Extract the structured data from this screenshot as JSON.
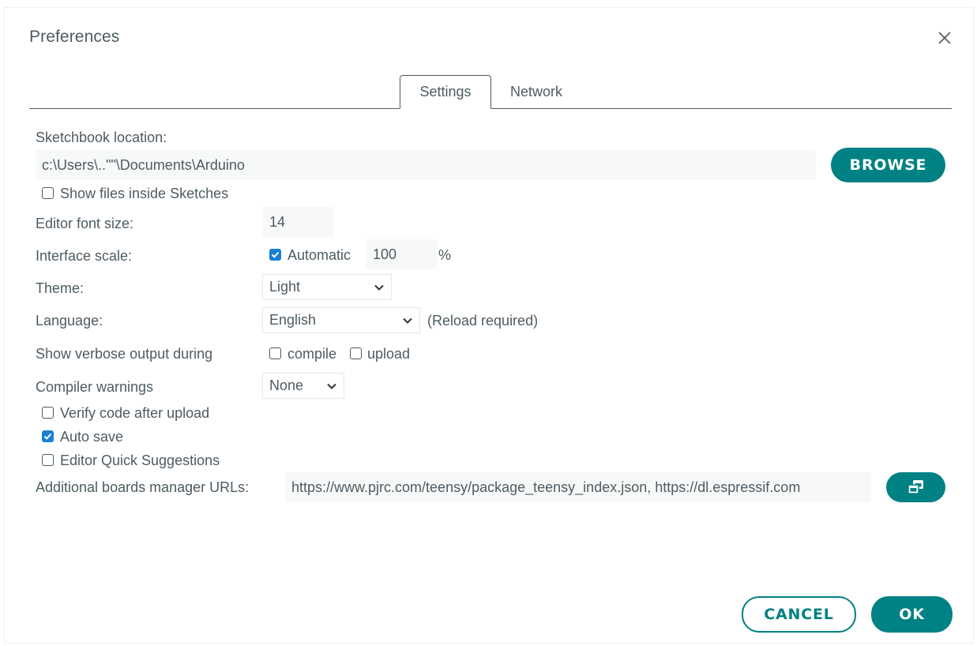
{
  "dialog": {
    "title": "Preferences",
    "close_icon": "close-icon"
  },
  "tabs": [
    {
      "label": "Settings",
      "active": true
    },
    {
      "label": "Network",
      "active": false
    }
  ],
  "settings": {
    "sketchbook_label": "Sketchbook location:",
    "sketchbook_path": "c:\\Users\\..\"\"\\Documents\\Arduino",
    "browse_label": "BROWSE",
    "show_files_label": "Show files inside Sketches",
    "show_files_checked": false,
    "font_size_label": "Editor font size:",
    "font_size_value": "14",
    "interface_scale_label": "Interface scale:",
    "automatic_label": "Automatic",
    "automatic_checked": true,
    "scale_value": "100",
    "scale_unit": "%",
    "theme_label": "Theme:",
    "theme_value": "Light",
    "language_label": "Language:",
    "language_value": "English",
    "reload_note": "(Reload required)",
    "verbose_label": "Show verbose output during",
    "compile_label": "compile",
    "compile_checked": false,
    "upload_label": "upload",
    "upload_checked": false,
    "warnings_label": "Compiler warnings",
    "warnings_value": "None",
    "verify_label": "Verify code after upload",
    "verify_checked": false,
    "autosave_label": "Auto save",
    "autosave_checked": true,
    "quick_suggestions_label": "Editor Quick Suggestions",
    "quick_suggestions_checked": false,
    "boards_urls_label": "Additional boards manager URLs:",
    "boards_urls_value": "https://www.pjrc.com/teensy/package_teensy_index.json, https://dl.espressif.com",
    "open_editor_icon": "open-in-window-icon"
  },
  "footer": {
    "cancel_label": "CANCEL",
    "ok_label": "OK"
  },
  "colors": {
    "accent": "#008184",
    "checkbox": "#1a7fd4",
    "text": "#4e5b61"
  }
}
